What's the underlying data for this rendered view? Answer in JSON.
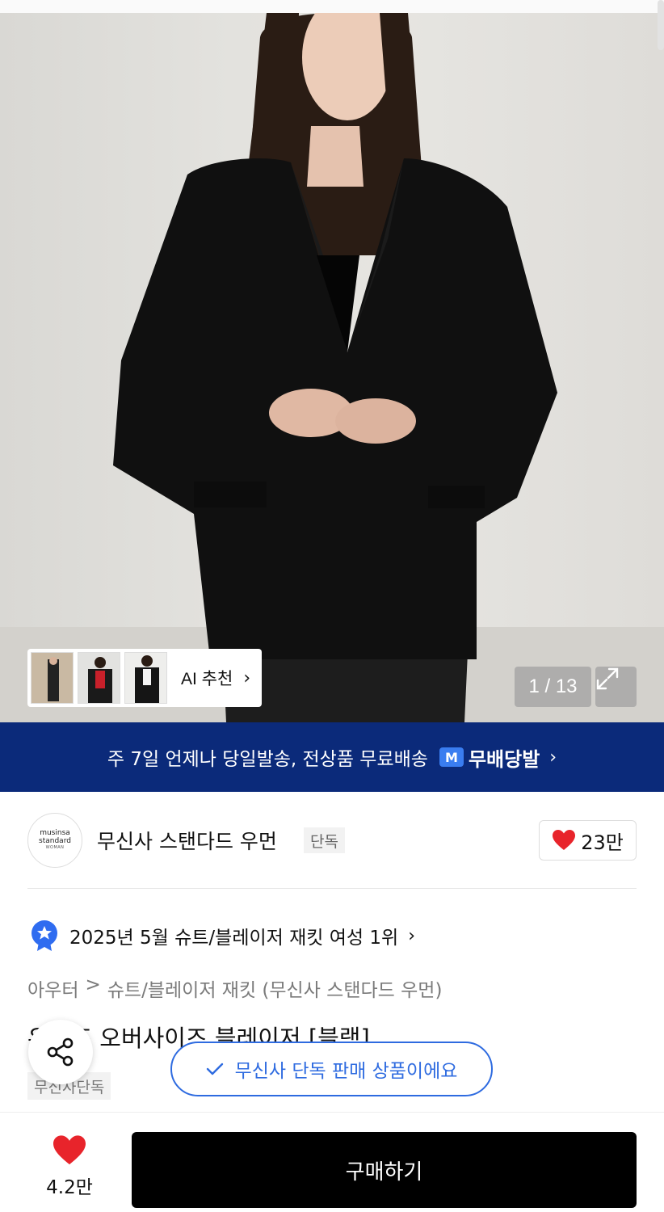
{
  "hero": {
    "image_alt": "",
    "ai_recommend_label": "AI 추천",
    "counter": "1 / 13"
  },
  "banner": {
    "text": "주 7일 언제나 당일발송, 전상품 무료배송",
    "badge": "M",
    "brand": "무배당발"
  },
  "brand": {
    "logo_line1": "musinsa",
    "logo_line2": "standard",
    "logo_line3": "WOMAN",
    "name": "무신사 스탠다드 우먼",
    "tag": "단독",
    "likes": "23만"
  },
  "ranking": {
    "text": "2025년 5월 슈트/블레이저 재킷 여성 1위"
  },
  "breadcrumb": {
    "category1": "아우터",
    "separator": ">",
    "category2": "슈트/블레이저 재킷 (무신사 스탠다드 우먼)"
  },
  "product": {
    "title": "우먼즈 오버사이즈 블레이저 [블랙]",
    "exclusive_tag": "무신사단독"
  },
  "toast": {
    "text": "무신사 단독 판매 상품이에요"
  },
  "bottom": {
    "wish_count": "4.2만",
    "buy_label": "구매하기"
  },
  "colors": {
    "banner_bg": "#0b2a7a",
    "accent_blue": "#2e6be0",
    "heart_red": "#e8242b",
    "buy_bg": "#000000"
  }
}
